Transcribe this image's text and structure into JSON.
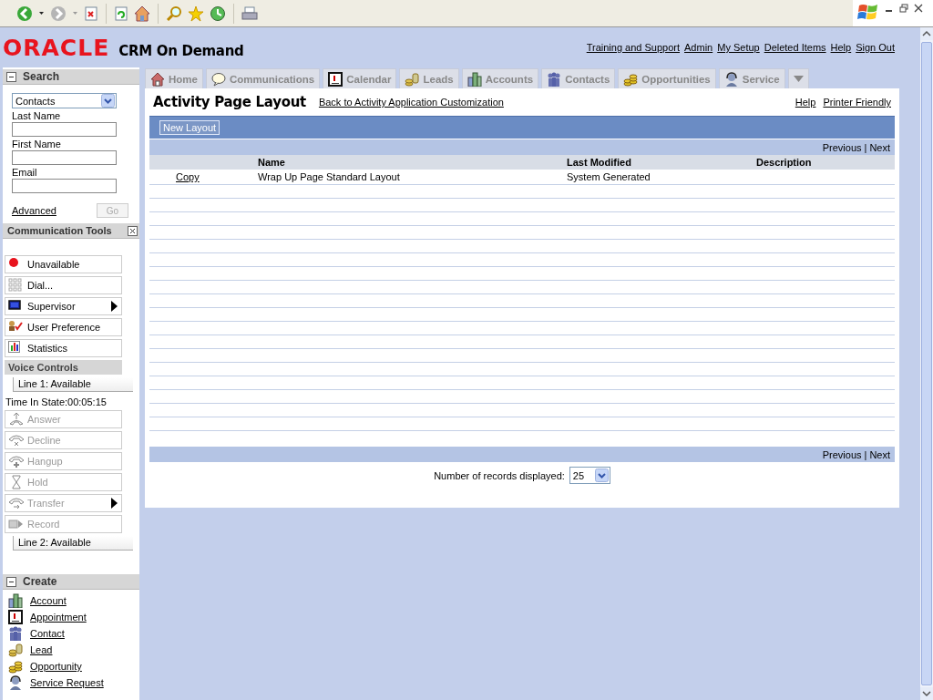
{
  "header": {
    "logo": "ORACLE",
    "product": "CRM On Demand",
    "links": [
      "Training and Support",
      "Admin",
      "My Setup",
      "Deleted Items",
      "Help",
      "Sign Out"
    ]
  },
  "search": {
    "title": "Search",
    "object": "Contacts",
    "fields": [
      {
        "label": "Last Name"
      },
      {
        "label": "First Name"
      },
      {
        "label": "Email"
      }
    ],
    "advanced": "Advanced",
    "go": {
      "label": "Go",
      "disabled": true
    }
  },
  "communication_tools": {
    "title": "Communication Tools",
    "buttons": [
      {
        "label": "Unavailable",
        "disabled": false,
        "submenu": false
      },
      {
        "label": "Dial...",
        "disabled": false,
        "submenu": false
      },
      {
        "label": "Supervisor",
        "disabled": false,
        "submenu": true
      },
      {
        "label": "User Preference",
        "disabled": false,
        "submenu": false
      },
      {
        "label": "Statistics",
        "disabled": false,
        "submenu": false
      }
    ],
    "voice_title": "Voice Controls",
    "line_1": "Line 1: Available",
    "time_in_state": "Time In State:00:05:15",
    "voice_buttons": [
      {
        "label": "Answer",
        "disabled": true,
        "submenu": false
      },
      {
        "label": "Decline",
        "disabled": true,
        "submenu": false
      },
      {
        "label": "Hangup",
        "disabled": true,
        "submenu": false
      },
      {
        "label": "Hold",
        "disabled": true,
        "submenu": false
      },
      {
        "label": "Transfer",
        "disabled": true,
        "submenu": true
      },
      {
        "label": "Record",
        "disabled": true,
        "submenu": false
      }
    ],
    "line_2": "Line 2: Available"
  },
  "create": {
    "title": "Create",
    "items": [
      "Account",
      "Appointment",
      "Contact",
      "Lead",
      "Opportunity",
      "Service Request"
    ]
  },
  "tabs": [
    "Home",
    "Communications",
    "Calendar",
    "Leads",
    "Accounts",
    "Contacts",
    "Opportunities",
    "Service"
  ],
  "content": {
    "title": "Activity Page Layout",
    "back_link": "Back to Activity Application Customization",
    "links": [
      "Help",
      "Printer Friendly"
    ],
    "new_button": "New Layout",
    "top_pager": {
      "previous": "Previous",
      "separator": "|",
      "next": "Next"
    },
    "table": {
      "columns": [
        "Name",
        "Last Modified",
        "Description"
      ],
      "rows": [
        {
          "action": "Copy",
          "name": "Wrap Up Page Standard Layout",
          "last_modified": "System Generated"
        }
      ]
    },
    "bottom_pager": {
      "previous": "Previous",
      "separator": "|",
      "next": "Next"
    },
    "records": {
      "label": "Number of records displayed:",
      "value": "25"
    }
  }
}
